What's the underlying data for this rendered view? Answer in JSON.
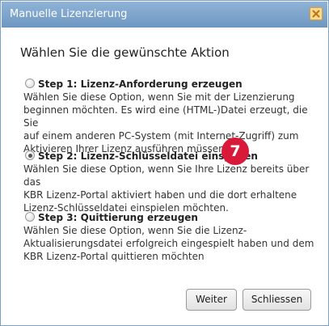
{
  "window": {
    "title": "Manuelle Lizenzierung"
  },
  "heading": "Wählen Sie die gewünschte Aktion",
  "options": [
    {
      "label": "Step 1: Lizenz-Anforderung erzeugen",
      "selected": false,
      "lines": [
        "Wählen Sie diese Option, wenn Sie mit der Lizenzierung",
        "beginnen möchten. Es wird eine (HTML-)Datei erzeugt, die Sie",
        "auf einem anderen PC-System (mit Internet-Zugriff) zum",
        "Aktivieren Ihrer Lizenz ausführen müssen."
      ]
    },
    {
      "label": "Step 2: Lizenz-Schlüsseldatei einspielen",
      "selected": true,
      "lines": [
        "Wählen Sie diese Option, wenn Sie Ihre Lizenz bereits über das",
        "KBR Lizenz-Portal aktiviert haben und die dort erhaltene",
        "Lizenz-Schlüsseldatei einspielen möchten."
      ]
    },
    {
      "label": "Step 3: Quittierung erzeugen",
      "selected": false,
      "lines": [
        "Wählen Sie diese Option, wenn Sie die Lizenz-",
        "Aktualisierungsdatei erfolgreich eingespielt haben und dem",
        "KBR Lizenz-Portal quittieren möchten"
      ]
    }
  ],
  "badge": "7",
  "buttons": {
    "next_label": "Weiter",
    "close_label": "Schliessen"
  },
  "colors": {
    "titlebar": "#7ba3cb",
    "badge": "#d9193a",
    "close_button": "#ffd98a"
  },
  "icons": {
    "close": "close-x-icon"
  }
}
